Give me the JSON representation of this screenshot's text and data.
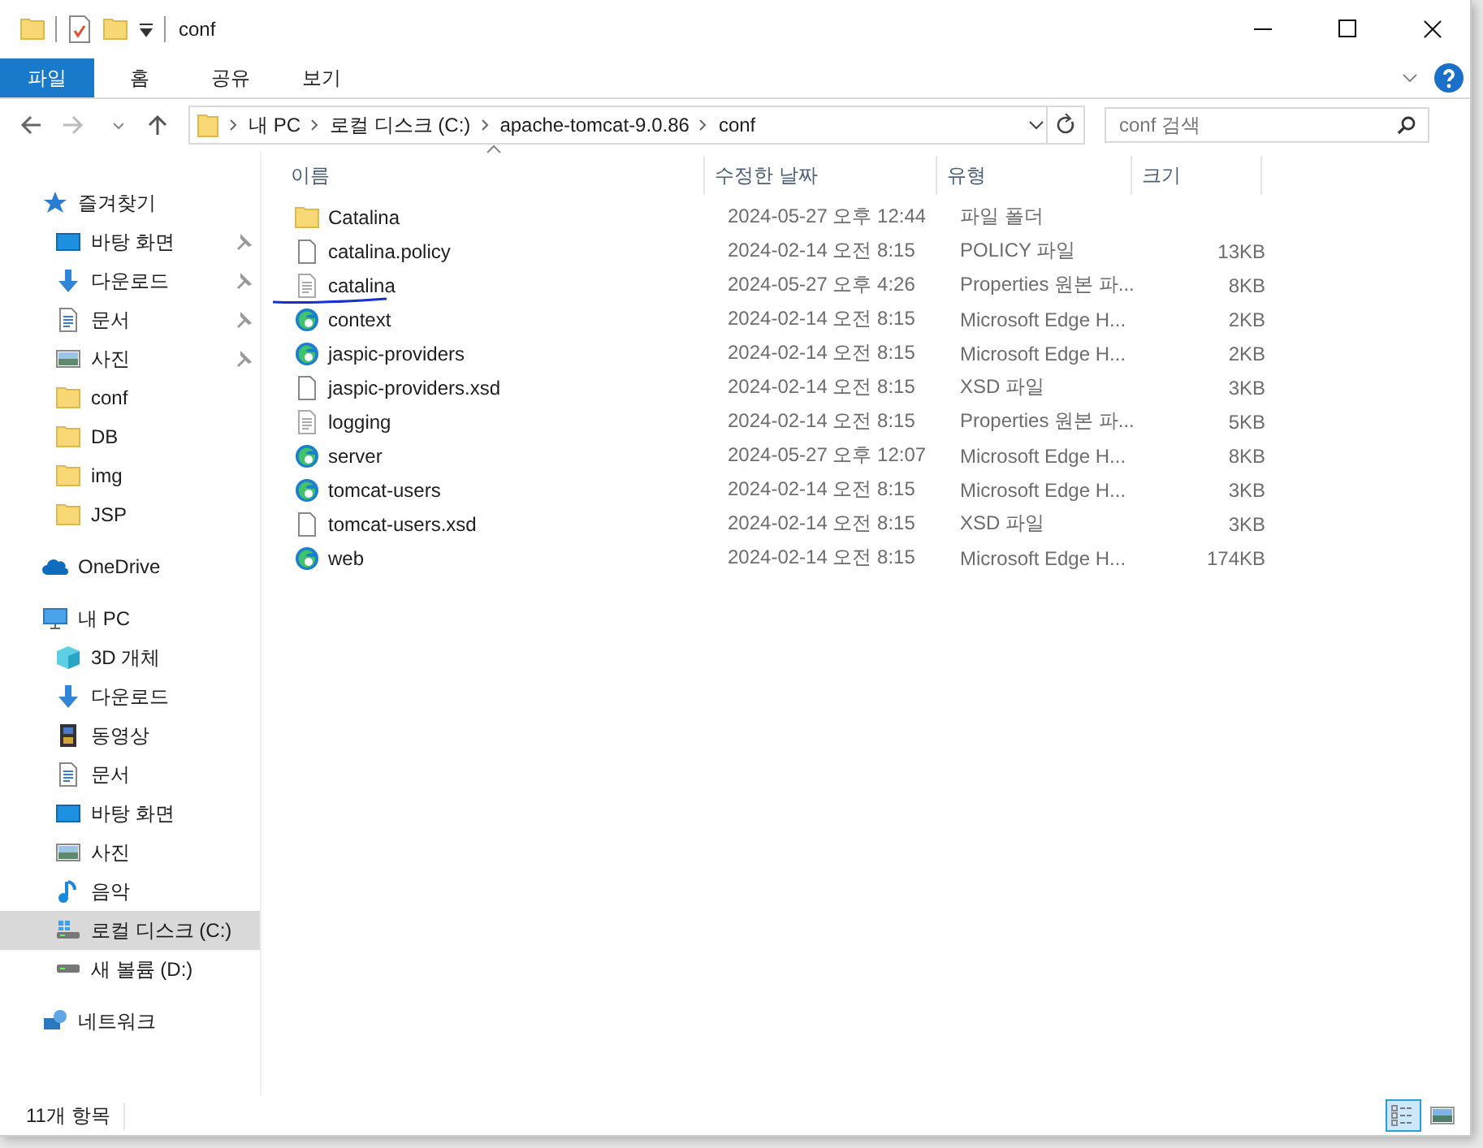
{
  "window": {
    "title": "conf"
  },
  "ribbon_tabs": [
    {
      "label": "파일",
      "selected": true
    },
    {
      "label": "홈",
      "selected": false
    },
    {
      "label": "공유",
      "selected": false
    },
    {
      "label": "보기",
      "selected": false
    }
  ],
  "address_bar": {
    "path": [
      {
        "label": "내 PC"
      },
      {
        "label": "로컬 디스크 (C:)"
      },
      {
        "label": "apache-tomcat-9.0.86"
      },
      {
        "label": "conf"
      }
    ]
  },
  "search": {
    "placeholder": "conf 검색"
  },
  "sidebar": {
    "items": [
      {
        "label": "즐겨찾기",
        "kind": "star",
        "selected": false,
        "children": [
          {
            "label": "바탕 화면",
            "kind": "desktop",
            "pinned": true,
            "selected": false
          },
          {
            "label": "다운로드",
            "kind": "download",
            "pinned": true,
            "selected": false
          },
          {
            "label": "문서",
            "kind": "document",
            "pinned": true,
            "selected": false
          },
          {
            "label": "사진",
            "kind": "photo",
            "pinned": true,
            "selected": false
          },
          {
            "label": "conf",
            "kind": "folder",
            "pinned": false,
            "selected": false
          },
          {
            "label": "DB",
            "kind": "folder",
            "pinned": false,
            "selected": false
          },
          {
            "label": "img",
            "kind": "folder",
            "pinned": false,
            "selected": false
          },
          {
            "label": "JSP",
            "kind": "folder",
            "pinned": false,
            "selected": false
          }
        ]
      },
      {
        "label": "OneDrive",
        "kind": "cloud",
        "selected": false
      },
      {
        "label": "내 PC",
        "kind": "pc",
        "selected": false,
        "children": [
          {
            "label": "3D 개체",
            "kind": "cube",
            "selected": false
          },
          {
            "label": "다운로드",
            "kind": "download",
            "selected": false
          },
          {
            "label": "동영상",
            "kind": "film",
            "selected": false
          },
          {
            "label": "문서",
            "kind": "document",
            "selected": false
          },
          {
            "label": "바탕 화면",
            "kind": "desktop",
            "selected": false
          },
          {
            "label": "사진",
            "kind": "photo",
            "selected": false
          },
          {
            "label": "음악",
            "kind": "music",
            "selected": false
          },
          {
            "label": "로컬 디스크 (C:)",
            "kind": "windrive",
            "selected": true
          },
          {
            "label": "새 볼륨 (D:)",
            "kind": "drive",
            "selected": false
          }
        ]
      },
      {
        "label": "네트워크",
        "kind": "network",
        "selected": false
      }
    ]
  },
  "table": {
    "columns": [
      {
        "label": "이름",
        "sorted": true
      },
      {
        "label": "수정한 날짜",
        "sorted": false
      },
      {
        "label": "유형",
        "sorted": false
      },
      {
        "label": "크기",
        "sorted": false
      }
    ],
    "rows": [
      {
        "name": "Catalina",
        "kind": "folder",
        "modified": "2024-05-27 오후 12:44",
        "type": "파일 폴더",
        "underlined": false
      },
      {
        "name": "catalina.policy",
        "kind": "file",
        "modified": "2024-02-14 오전 8:15",
        "type": "POLICY 파일",
        "size": "13KB",
        "underlined": false
      },
      {
        "name": "catalina",
        "kind": "text",
        "modified": "2024-05-27 오후 4:26",
        "type": "Properties 원본 파...",
        "size": "8KB",
        "underlined": true
      },
      {
        "name": "context",
        "kind": "edge",
        "modified": "2024-02-14 오전 8:15",
        "type": "Microsoft Edge H...",
        "size": "2KB",
        "underlined": false
      },
      {
        "name": "jaspic-providers",
        "kind": "edge",
        "modified": "2024-02-14 오전 8:15",
        "type": "Microsoft Edge H...",
        "size": "2KB",
        "underlined": false
      },
      {
        "name": "jaspic-providers.xsd",
        "kind": "file",
        "modified": "2024-02-14 오전 8:15",
        "type": "XSD 파일",
        "size": "3KB",
        "underlined": false
      },
      {
        "name": "logging",
        "kind": "text",
        "modified": "2024-02-14 오전 8:15",
        "type": "Properties 원본 파...",
        "size": "5KB",
        "underlined": false
      },
      {
        "name": "server",
        "kind": "edge",
        "modified": "2024-05-27 오후 12:07",
        "type": "Microsoft Edge H...",
        "size": "8KB",
        "underlined": false
      },
      {
        "name": "tomcat-users",
        "kind": "edge",
        "modified": "2024-02-14 오전 8:15",
        "type": "Microsoft Edge H...",
        "size": "3KB",
        "underlined": false
      },
      {
        "name": "tomcat-users.xsd",
        "kind": "file",
        "modified": "2024-02-14 오전 8:15",
        "type": "XSD 파일",
        "size": "3KB",
        "underlined": false
      },
      {
        "name": "web",
        "kind": "edge",
        "modified": "2024-02-14 오전 8:15",
        "type": "Microsoft Edge H...",
        "size": "174KB",
        "underlined": false
      }
    ]
  },
  "status_bar": {
    "count": "11개 항목",
    "views": [
      {
        "kind": "details",
        "selected": true
      },
      {
        "kind": "large",
        "selected": false
      }
    ]
  }
}
